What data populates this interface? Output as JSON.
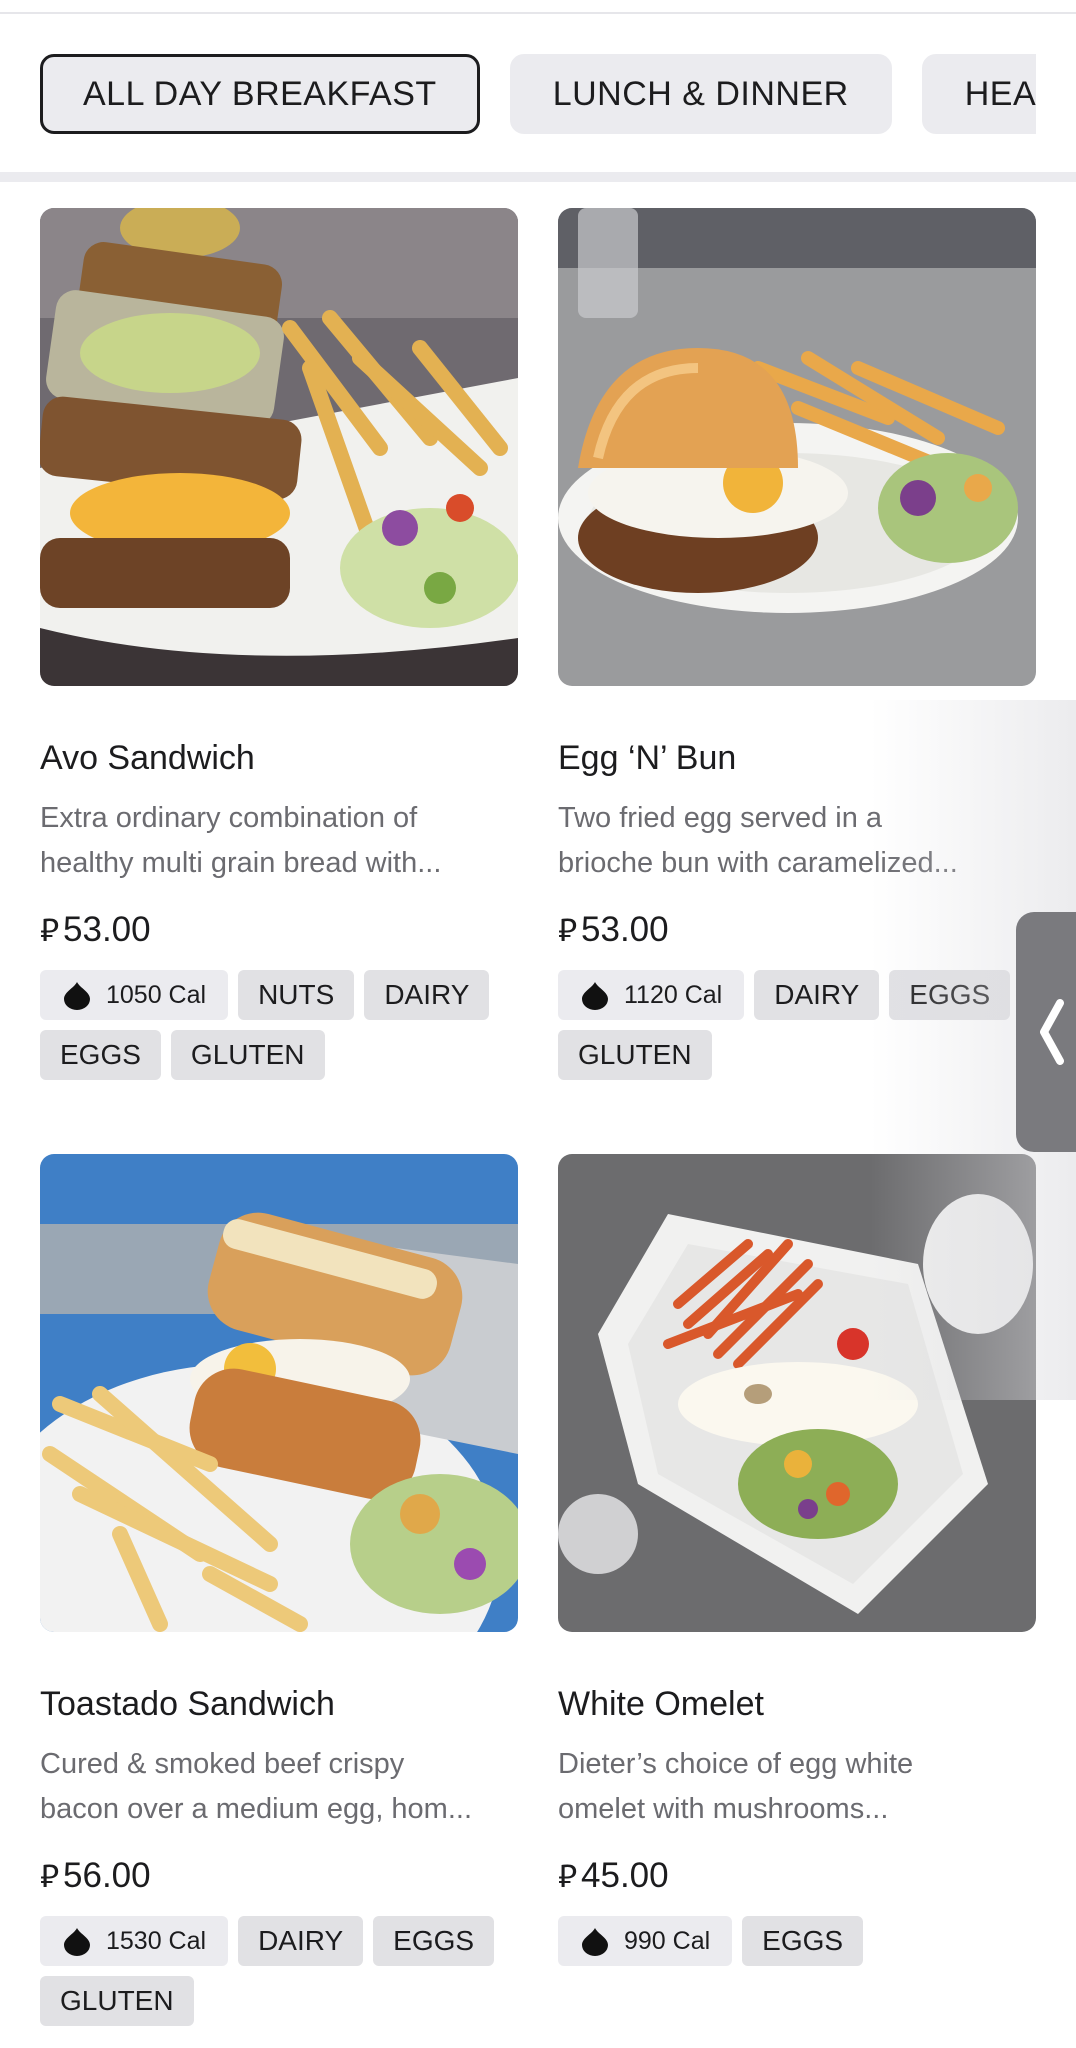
{
  "tabs": [
    {
      "label": "ALL DAY BREAKFAST",
      "active": true
    },
    {
      "label": "LUNCH & DINNER",
      "active": false
    },
    {
      "label": "HEA",
      "active": false
    }
  ],
  "currency_symbol": "⃁",
  "items": [
    {
      "name": "Avo Sandwich",
      "desc_line1": "Extra ordinary combination of",
      "desc_line2": "healthy multi grain bread with...",
      "price": "53.00",
      "calories": "1050 Cal",
      "tags": [
        "NUTS",
        "DAIRY",
        "EGGS",
        "GLUTEN"
      ]
    },
    {
      "name": "Egg ‘N’ Bun",
      "desc_line1": "Two fried egg served in a",
      "desc_line2": "brioche bun with caramelized...",
      "price": "53.00",
      "calories": "1120 Cal",
      "tags": [
        "DAIRY",
        "EGGS",
        "GLUTEN"
      ]
    },
    {
      "name": "Toastado Sandwich",
      "desc_line1": "Cured & smoked beef crispy",
      "desc_line2": "bacon over a medium egg, hom...",
      "price": "56.00",
      "calories": "1530 Cal",
      "tags": [
        "DAIRY",
        "EGGS",
        "GLUTEN"
      ]
    },
    {
      "name": "White Omelet",
      "desc_line1": "Dieter’s choice of egg white",
      "desc_line2": "omelet with mushrooms...",
      "price": "45.00",
      "calories": "990 Cal",
      "tags": [
        "EGGS"
      ]
    }
  ]
}
